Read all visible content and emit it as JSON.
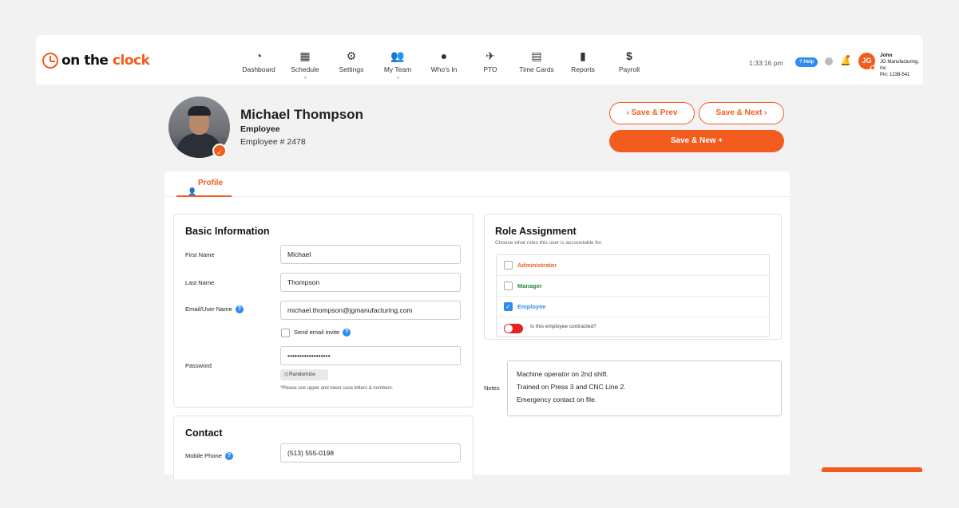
{
  "brand": {
    "logo_part1": "on the ",
    "logo_part2": "clock",
    "accent": "#f25c1f",
    "info_blue": "#2d8cf0"
  },
  "nav": [
    {
      "label": "Dashboard",
      "icon": "gauge-icon"
    },
    {
      "label": "Schedule",
      "icon": "calendar-icon"
    },
    {
      "label": "Settings",
      "icon": "gears-icon"
    },
    {
      "label": "My Team",
      "icon": "users-icon"
    },
    {
      "label": "Who's In",
      "icon": "user-clock-icon"
    },
    {
      "label": "PTO",
      "icon": "plane-icon"
    },
    {
      "label": "Time Cards",
      "icon": "calculator-icon"
    },
    {
      "label": "Reports",
      "icon": "bar-chart-icon"
    },
    {
      "label": "Payroll",
      "icon": "dollar-icon"
    }
  ],
  "topbar": {
    "time": "1:33:16 pm",
    "help": "? Help",
    "user_initials": "JG",
    "user_name": "John",
    "company": "JG Manufacturing, Inc",
    "pin": "Pin: 1238-541"
  },
  "employee": {
    "name": "Michael Thompson",
    "role": "Employee",
    "number": "Employee # 2478"
  },
  "actions": {
    "prev": "‹  Save & Prev",
    "next": "Save & Next  ›",
    "new": "Save & New +"
  },
  "tabs": {
    "profile": "Profile"
  },
  "basic": {
    "title": "Basic Information",
    "first_name_label": "First Name",
    "first_name": "Michael",
    "last_name_label": "Last Name",
    "last_name": "Thompson",
    "email_label": "Email/User Name",
    "email": "michael.thompson@jgmanufacturing.com",
    "send_invite": "Send email invite",
    "password_label": "Password",
    "password": "••••••••••••••••••",
    "randomize": "⤨ Randomize",
    "hint": "*Please use upper and lower case letters & numbers."
  },
  "contact": {
    "title": "Contact",
    "mobile_label": "Mobile Phone",
    "mobile": "(513) 555-0198"
  },
  "role": {
    "title": "Role Assignment",
    "subtitle": "Choose what roles this user is accountable for.",
    "items": [
      {
        "label": "Administrator",
        "checked": false,
        "color": "#f25c1f"
      },
      {
        "label": "Manager",
        "checked": false,
        "color": "#2a8a3a"
      },
      {
        "label": "Employee",
        "checked": true,
        "color": "#2d8cf0"
      }
    ],
    "contracted": "Is this employee contracted?"
  },
  "notes": {
    "label": "Notes",
    "lines": [
      "Machine operator on 2nd shift.",
      "Trained on Press 3 and CNC Line 2.",
      "Emergency contact on file."
    ]
  }
}
